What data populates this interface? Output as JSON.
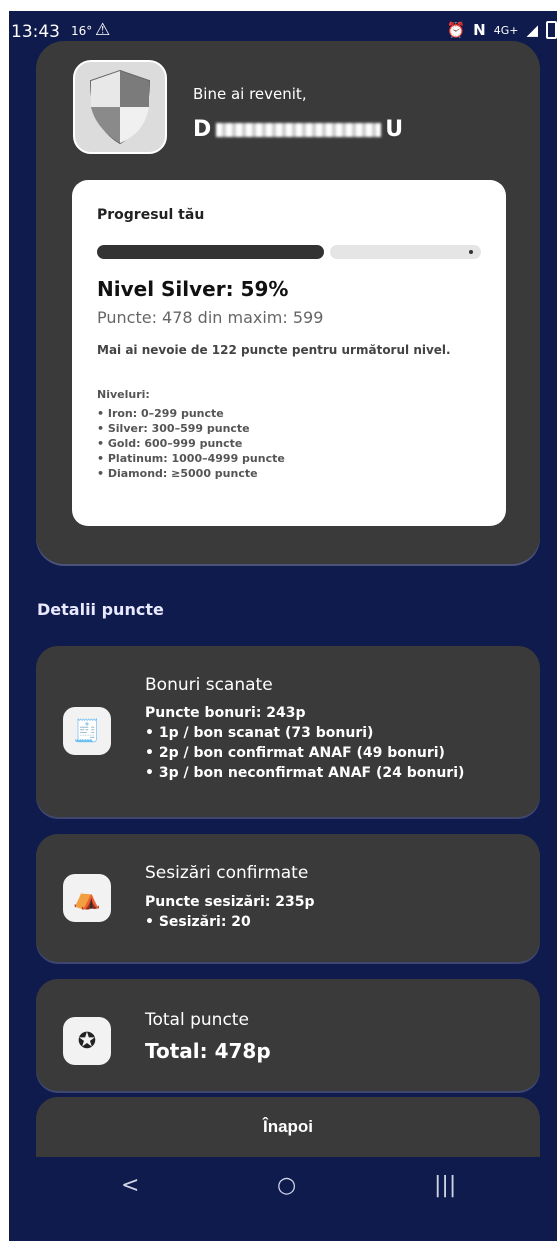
{
  "status_bar": {
    "time": "13:43",
    "temperature": "16°",
    "warning_icon": "warning-icon",
    "network": "4G+"
  },
  "profile": {
    "greeting": "Bine ai revenit,",
    "username_start": "D",
    "username_end": "U"
  },
  "progress": {
    "title": "Progresul tău",
    "fill_fraction": 0.59,
    "level": "Nivel Silver: 59%",
    "points": "Puncte: 478 din maxim: 599",
    "need": "Mai ai nevoie de 122 puncte pentru următorul nivel.",
    "levels_title": "Niveluri:",
    "levels": [
      "• Iron: 0–299 puncte",
      "• Silver: 300–599 puncte",
      "• Gold: 600–999 puncte",
      "• Platinum: 1000–4999 puncte",
      "• Diamond: ≥5000 puncte"
    ]
  },
  "details": {
    "section_title": "Detalii puncte",
    "receipts": {
      "title": "Bonuri scanate",
      "main": "Puncte bonuri: 243p",
      "items": [
        "• 1p / bon scanat (73 bonuri)",
        "• 2p / bon confirmat ANAF (49 bonuri)",
        "• 3p / bon neconfirmat ANAF (24 bonuri)"
      ]
    },
    "reports": {
      "title": "Sesizări confirmate",
      "main": "Puncte sesizări: 235p",
      "items": [
        "• Sesizări: 20"
      ]
    },
    "total": {
      "title": "Total puncte",
      "main": "Total: 478p"
    }
  },
  "back_label": "Înapoi",
  "nav": {
    "back": "<",
    "home": "○",
    "recent": "|||"
  }
}
